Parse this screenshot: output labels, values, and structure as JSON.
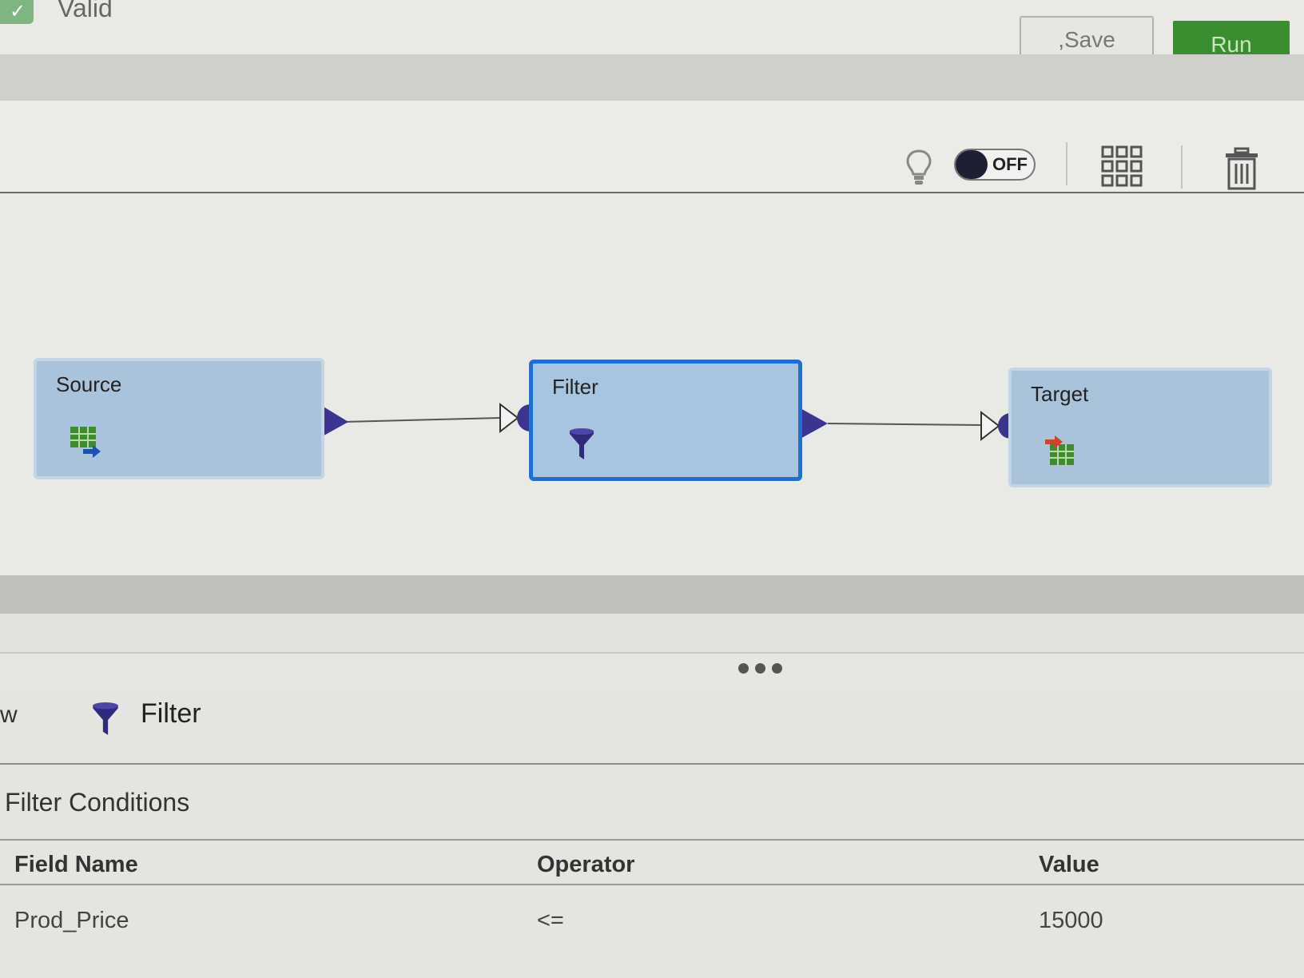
{
  "header": {
    "status_label": "Valid",
    "save_label": ",Save",
    "run_label": "Run",
    "colors": {
      "run": "#3b8e2f",
      "valid": "#7fb580"
    }
  },
  "toolbar": {
    "toggle_label": "OFF",
    "icons": [
      "lightbulb-icon",
      "grid-icon",
      "trash-icon"
    ]
  },
  "canvas": {
    "nodes": [
      {
        "title": "Source",
        "icon": "source-table-icon"
      },
      {
        "title": "Filter",
        "icon": "funnel-icon",
        "selected": true
      },
      {
        "title": "Target",
        "icon": "target-table-icon"
      }
    ],
    "colors": {
      "node": "#a9c3db",
      "selected_border": "#1e6fd1",
      "port": "#3b3590"
    }
  },
  "panel": {
    "left_fragment": "w",
    "title": "Filter",
    "section_title": "Filter Conditions",
    "columns": [
      "Field Name",
      "Operator",
      "Value"
    ],
    "rows": [
      {
        "field_name": "Prod_Price",
        "operator": "<=",
        "value": "15000"
      }
    ]
  }
}
